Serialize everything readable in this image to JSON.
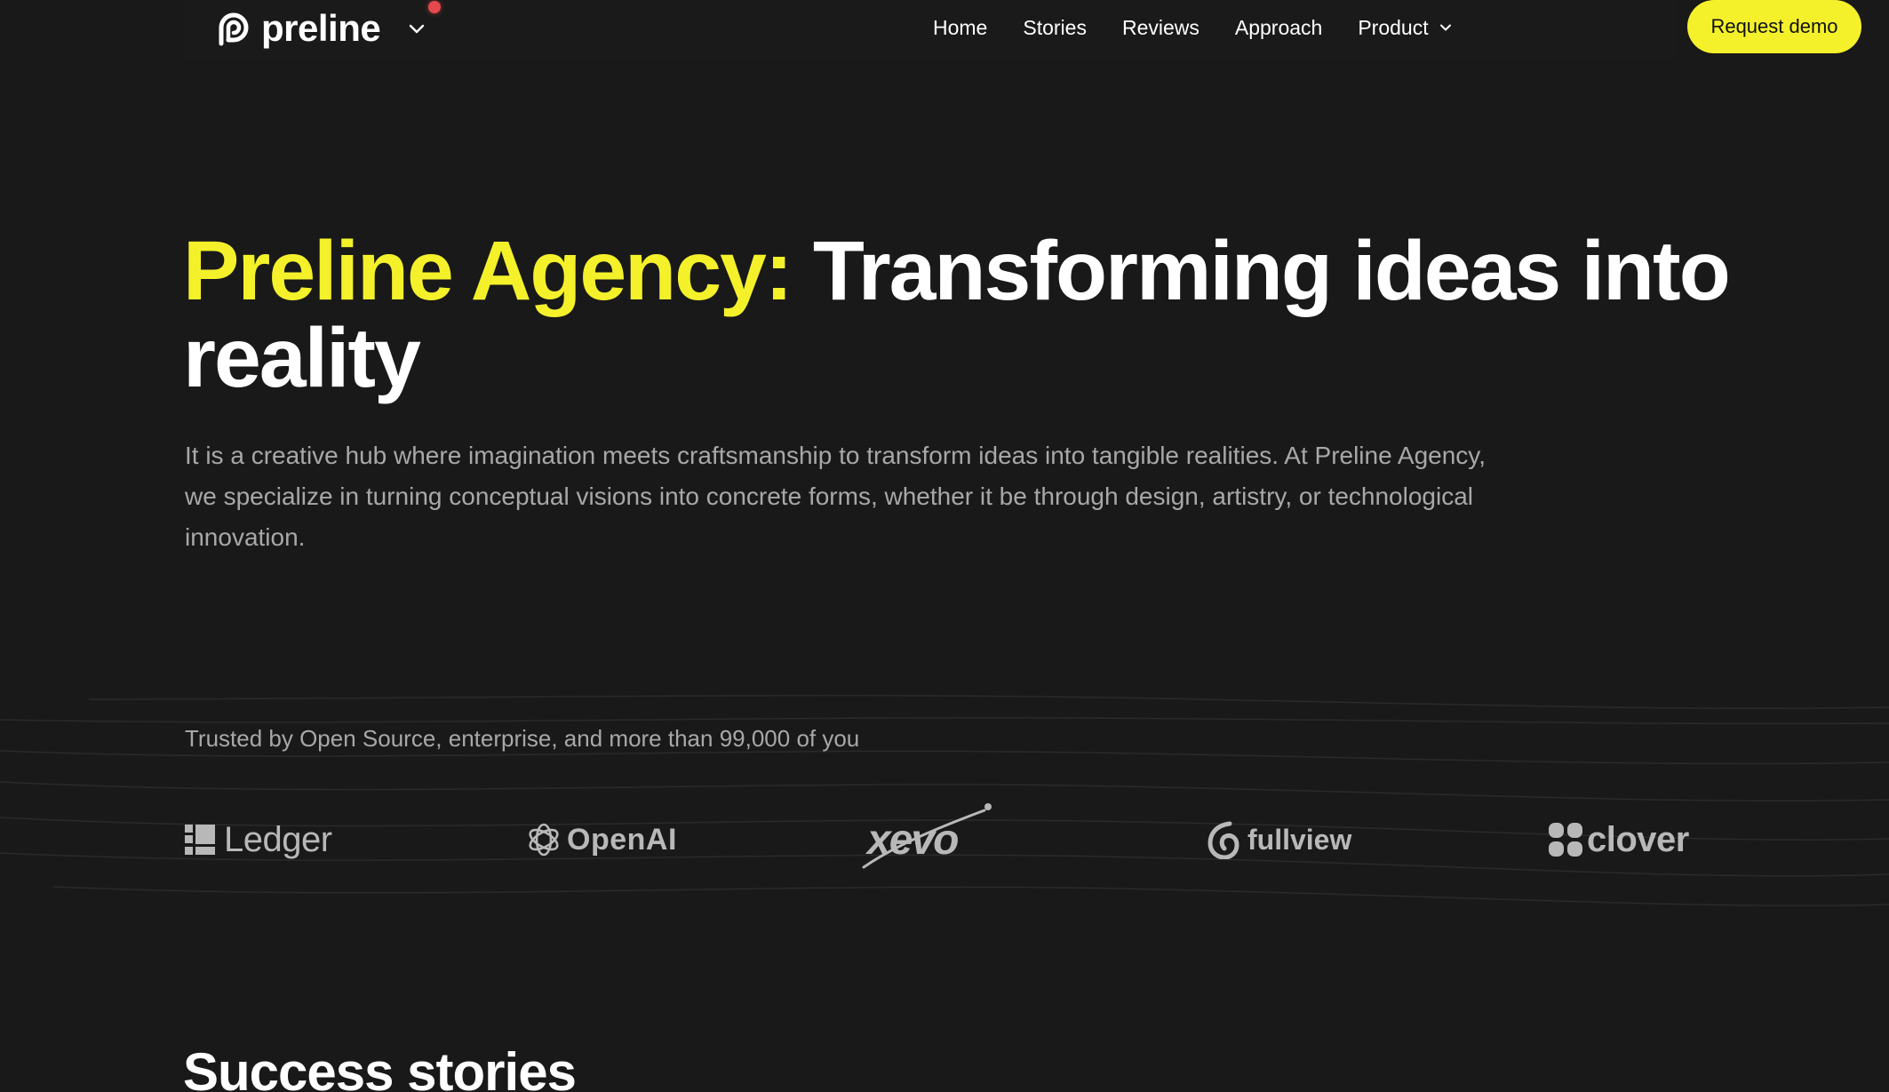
{
  "brand": {
    "name": "preline",
    "logo_icon": "preline-logo-icon",
    "toggle_icon": "chevron-down-icon"
  },
  "nav": {
    "items": [
      {
        "label": "Home"
      },
      {
        "label": "Stories"
      },
      {
        "label": "Reviews"
      },
      {
        "label": "Approach"
      }
    ],
    "product": {
      "label": "Product",
      "icon": "chevron-down-icon"
    },
    "cta_label": "Request demo"
  },
  "hero": {
    "title_accent": "Preline Agency:",
    "title_rest": "Transforming ideas into reality",
    "description": "It is a creative hub where imagination meets craftsmanship to transform ideas into tangible realities. At Preline Agency, we specialize in turning conceptual visions into concrete forms, whether it be through design, artistry, or technological innovation."
  },
  "trusted": {
    "text": "Trusted by Open Source, enterprise, and more than 99,000 of you",
    "logos": [
      {
        "name": "Ledger",
        "icon": "ledger-logo-icon"
      },
      {
        "name": "OpenAI",
        "icon": "openai-logo-icon"
      },
      {
        "name": "xevo",
        "icon": "xevo-logo-icon"
      },
      {
        "name": "fullview",
        "icon": "fullview-logo-icon"
      },
      {
        "name": "clover",
        "icon": "clover-logo-icon"
      }
    ]
  },
  "stories": {
    "title": "Success stories"
  },
  "colors": {
    "background": "#191919",
    "accent": "#f4f12b",
    "text": "#ffffff",
    "muted_text": "#a8a8a8",
    "logo_gray": "#b8b8b8",
    "notification_dot": "#e5484d"
  }
}
